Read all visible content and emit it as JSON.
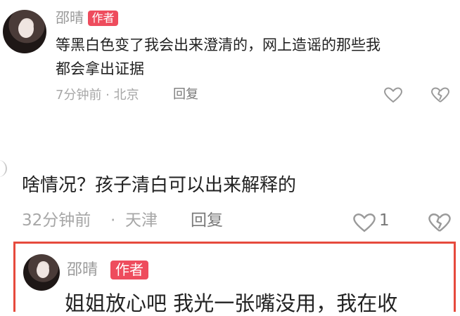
{
  "comments": [
    {
      "author": "邵晴",
      "badge": "作者",
      "text_line1": "等黑白色变了我会出来澄清的，网上造谣的那些我",
      "text_line2": "都会拿出证据",
      "time_location": "7分钟前 · 北京",
      "reply_label": "回复"
    },
    {
      "text": "啥情况？孩子清白可以出来解释的",
      "time": "32分钟前",
      "location": "天津",
      "reply_label": "回复",
      "like_count": "1"
    },
    {
      "author": "邵晴",
      "badge": "作者",
      "text_partial": "姐姐放心吧 我光一张嘴没用，我在收"
    }
  ],
  "icons": {
    "like": "heart-outline-icon",
    "dislike": "broken-heart-icon"
  },
  "colors": {
    "badge_bg": "#ee4c5d",
    "highlight_border": "#e64a3d",
    "meta_gray": "#a7a7a7"
  }
}
